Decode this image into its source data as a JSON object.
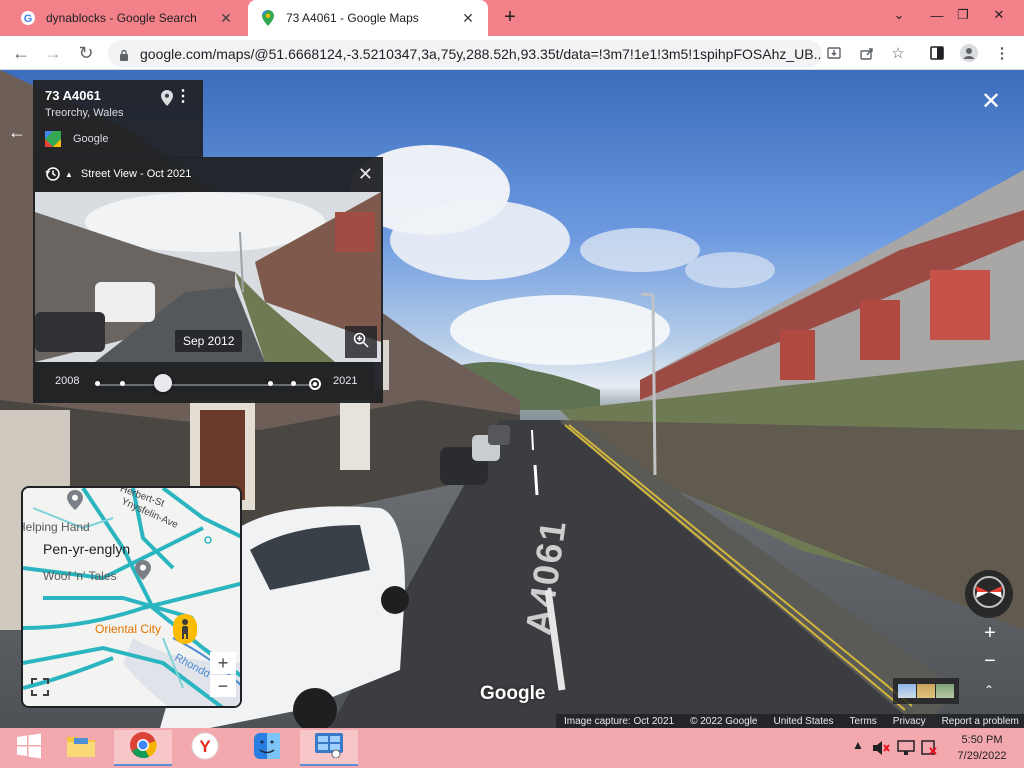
{
  "browser": {
    "tabs": [
      {
        "title": "dynablocks - Google Search",
        "icon": "google-g-icon",
        "active": false
      },
      {
        "title": "73 A4061 - Google Maps",
        "icon": "maps-pin-icon",
        "active": true
      }
    ],
    "new_tab_label": "+",
    "window_controls": {
      "chevron": "⌄",
      "minimize": "—",
      "restore": "❐",
      "close": "✕"
    },
    "url": "google.com/maps/@51.6668124,-3.5210347,3a,75y,288.52h,93.35t/data=!3m7!1e1!3m5!1spihpFOSAhz_UB..."
  },
  "place": {
    "address": "73 A4061",
    "city": "Treorchy, Wales",
    "source": "Google"
  },
  "time_machine": {
    "title": "Street View - Oct 2021",
    "preview_date": "Sep 2012",
    "start_year": "2008",
    "end_year": "2021",
    "selected_fraction": 0.3
  },
  "minimap": {
    "labels": {
      "street1": "Herbert-St",
      "street2": "Ynysfelin-Ave",
      "helping_hand": "Helping Hand",
      "village": "Pen-yr-englyn",
      "woof": "Woof 'n' Tales",
      "oriental": "Oriental City",
      "river": "Rhondd"
    },
    "zoom_in": "+",
    "zoom_out": "−"
  },
  "scene": {
    "road_marking": "A4061"
  },
  "overlay": {
    "google_logo": "Google",
    "zoom_in": "+",
    "zoom_out": "−",
    "expand": "⌃"
  },
  "footer": {
    "capture": "Image capture: Oct 2021",
    "copyright": "© 2022 Google",
    "region": "United States",
    "terms": "Terms",
    "privacy": "Privacy",
    "report": "Report a problem"
  },
  "taskbar": {
    "time": "5:50 PM",
    "date": "7/29/2022"
  },
  "colors": {
    "tabstrip": "#f3818a",
    "taskbar": "#f3a8ad",
    "map_road": "#2bb5c0"
  }
}
